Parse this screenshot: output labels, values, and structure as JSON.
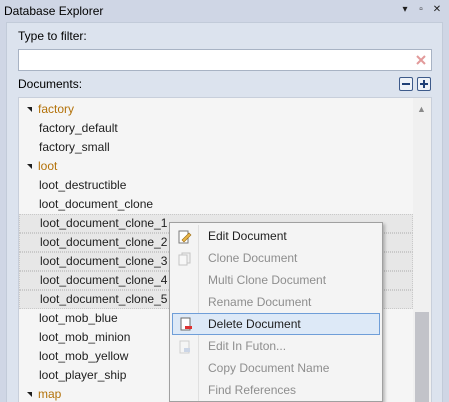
{
  "window": {
    "title": "Database Explorer",
    "pin_glyph": "▾",
    "maximize_glyph": "▫",
    "close_glyph": "✕"
  },
  "filter": {
    "label": "Type to filter:",
    "value": "",
    "clear_icon": "clear-x-icon"
  },
  "documents": {
    "label": "Documents:",
    "collapse_icon": "collapse-all-icon",
    "expand_icon": "expand-all-icon"
  },
  "tree": {
    "rows": [
      {
        "text": "factory",
        "type": "folder"
      },
      {
        "text": "factory_default",
        "type": "doc"
      },
      {
        "text": "factory_small",
        "type": "doc"
      },
      {
        "text": "loot",
        "type": "folder"
      },
      {
        "text": "loot_destructible",
        "type": "doc"
      },
      {
        "text": "loot_document_clone",
        "type": "doc"
      },
      {
        "text": "loot_document_clone_1",
        "type": "doc",
        "selected": true
      },
      {
        "text": "loot_document_clone_2",
        "type": "doc",
        "selected": true
      },
      {
        "text": "loot_document_clone_3",
        "type": "doc",
        "selected": true
      },
      {
        "text": "loot_document_clone_4",
        "type": "doc",
        "selected": true
      },
      {
        "text": "loot_document_clone_5",
        "type": "doc",
        "selected": true
      },
      {
        "text": "loot_mob_blue",
        "type": "doc"
      },
      {
        "text": "loot_mob_minion",
        "type": "doc"
      },
      {
        "text": "loot_mob_yellow",
        "type": "doc"
      },
      {
        "text": "loot_player_ship",
        "type": "doc"
      },
      {
        "text": "map",
        "type": "folder"
      }
    ]
  },
  "context_menu": {
    "items": [
      {
        "label": "Edit Document",
        "enabled": true,
        "icon": "edit-document-icon"
      },
      {
        "label": "Clone Document",
        "enabled": false,
        "icon": "clone-document-icon"
      },
      {
        "label": "Multi Clone Document",
        "enabled": false
      },
      {
        "label": "Rename Document",
        "enabled": false
      },
      {
        "label": "Delete Document",
        "enabled": true,
        "highlighted": true,
        "icon": "delete-document-icon"
      },
      {
        "label": "Edit In Futon...",
        "enabled": false,
        "icon": "futon-icon"
      },
      {
        "label": "Copy Document Name",
        "enabled": false
      },
      {
        "label": "Find References",
        "enabled": false
      }
    ]
  },
  "colors": {
    "folder_text": "#b3720a",
    "accent_border": "#6f9ed8",
    "highlight_bg": "#dde9f7",
    "disabled_text": "#8e8e8e"
  }
}
